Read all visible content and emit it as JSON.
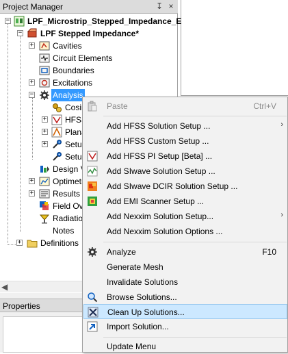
{
  "project_manager": {
    "title": "Project Manager",
    "pin_glyph": "↧",
    "close_glyph": "×",
    "items": [
      {
        "label": "LPF_Microstrip_Stepped_Impedance_E",
        "icon": "project-icon"
      },
      {
        "label": "LPF Stepped Impedance*",
        "icon": "design-icon"
      },
      {
        "label": "Cavities",
        "icon": "cavities-icon"
      },
      {
        "label": "Circuit Elements",
        "icon": "circuit-elements-icon"
      },
      {
        "label": "Boundaries",
        "icon": "boundaries-icon"
      },
      {
        "label": "Excitations",
        "icon": "excitations-icon"
      },
      {
        "label": "Analysis",
        "icon": "analysis-icon"
      },
      {
        "label": "Cosin",
        "icon": "cosim-icon"
      },
      {
        "label": "HFSS",
        "icon": "hfss-icon"
      },
      {
        "label": "Plana",
        "icon": "planar-icon"
      },
      {
        "label": "Setup",
        "icon": "setup-icon"
      },
      {
        "label": "Setup",
        "icon": "setup-icon"
      },
      {
        "label": "Design Va",
        "icon": "design-variables-icon"
      },
      {
        "label": "Optimetr",
        "icon": "optimetrics-icon"
      },
      {
        "label": "Results",
        "icon": "results-icon"
      },
      {
        "label": "Field Ove",
        "icon": "field-overlays-icon"
      },
      {
        "label": "Radiation",
        "icon": "radiation-icon"
      },
      {
        "label": "Notes",
        "icon": "notes-icon"
      },
      {
        "label": "Definitions",
        "icon": "folder-icon"
      }
    ]
  },
  "properties": {
    "title": "Properties"
  },
  "context_menu": {
    "items": [
      {
        "label": "Paste",
        "shortcut": "Ctrl+V",
        "icon": "paste-icon",
        "disabled": true
      },
      {
        "label": "Add HFSS Solution Setup ...",
        "submenu_glyph": "›"
      },
      {
        "label": "Add HFSS Custom Setup ..."
      },
      {
        "label": "Add HFSS PI Setup [Beta] ...",
        "icon": "hfss-pi-icon"
      },
      {
        "label": "Add SIwave Solution Setup ...",
        "icon": "siwave-icon"
      },
      {
        "label": "Add SIwave DCIR Solution Setup ...",
        "icon": "dcir-icon"
      },
      {
        "label": "Add EMI Scanner Setup ...",
        "icon": "emi-scanner-icon"
      },
      {
        "label": "Add Nexxim Solution Setup...",
        "submenu_glyph": "›"
      },
      {
        "label": "Add Nexxim Solution Options ..."
      },
      {
        "label": "Analyze",
        "shortcut": "F10",
        "icon": "analyze-icon"
      },
      {
        "label": "Generate Mesh"
      },
      {
        "label": "Invalidate Solutions"
      },
      {
        "label": "Browse Solutions...",
        "icon": "browse-solutions-icon"
      },
      {
        "label": "Clean Up Solutions...",
        "icon": "clean-up-icon",
        "highlighted": true
      },
      {
        "label": "Import Solution...",
        "icon": "import-solution-icon"
      },
      {
        "label": "Update Menu"
      }
    ]
  },
  "colors": {
    "selection": "#3399ff",
    "menu_highlight": "#cce8ff",
    "menu_bg": "#f2f2f2",
    "panel_header": "#dcdcdc"
  }
}
